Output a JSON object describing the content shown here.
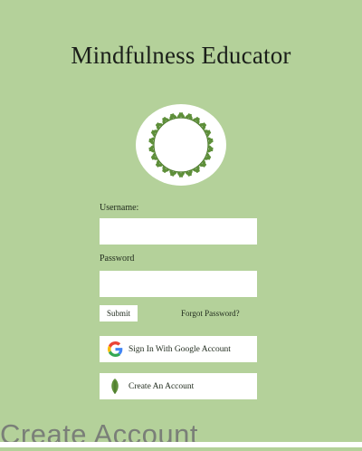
{
  "app": {
    "title": "Mindfulness Educator"
  },
  "login": {
    "username_label": "Username:",
    "username_value": "",
    "password_label": "Password",
    "password_value": "",
    "submit_label": "Submit",
    "forgot_label": "Forgot Password?"
  },
  "actions": {
    "google_label": "Sign In With Google Account",
    "google_icon": "google-g-icon",
    "create_label": "Create An Account",
    "create_icon": "leaf-icon"
  },
  "footer": {
    "heading": "Create Account"
  },
  "colors": {
    "background": "#b4d19a",
    "leaf": "#5e8f3a",
    "white": "#ffffff"
  }
}
